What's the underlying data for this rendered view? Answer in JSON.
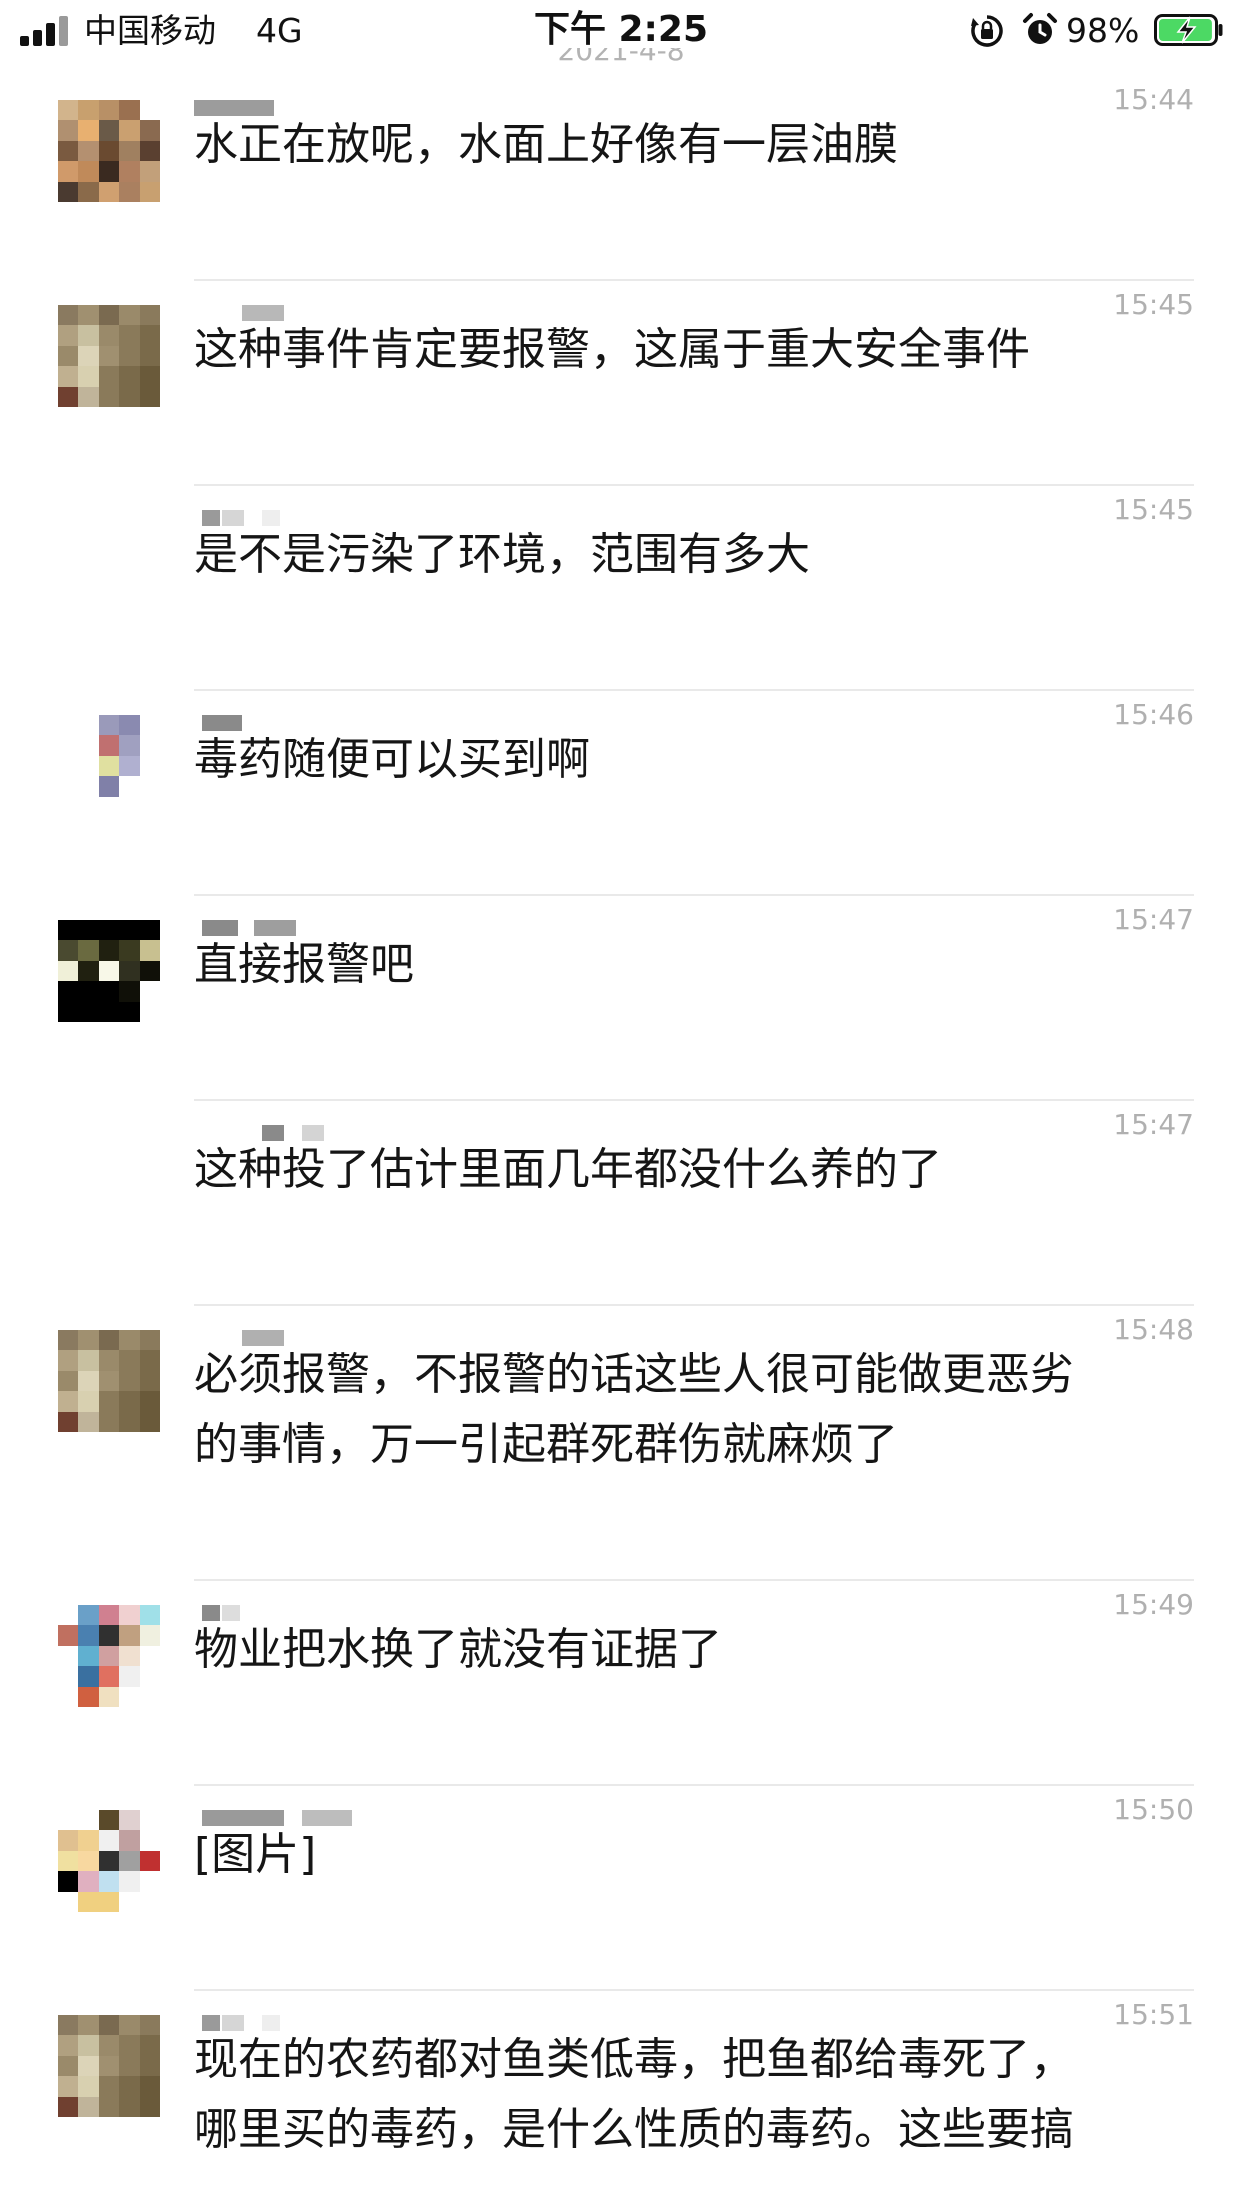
{
  "status_bar": {
    "carrier": "中国移动",
    "network": "4G",
    "time": "下午 2:25",
    "battery_percent": "98%",
    "battery_level": 0.98,
    "icons": [
      "signal-icon",
      "rotation-lock-icon",
      "alarm-icon",
      "battery-charging-icon"
    ]
  },
  "date_header": "2021-4-8",
  "colors": {
    "divider": "#e9e9e9",
    "time_text": "#b0b0b0",
    "battery_green": "#4cd964"
  },
  "messages": [
    {
      "time": "15:44",
      "lines": [
        "水正在放呢，水面上好像有一层油膜"
      ]
    },
    {
      "time": "15:45",
      "lines": [
        "这种事件肯定要报警，这属于重大安全事件"
      ]
    },
    {
      "time": "15:45",
      "lines": [
        "是不是污染了环境，范围有多大"
      ]
    },
    {
      "time": "15:46",
      "lines": [
        "毒药随便可以买到啊"
      ]
    },
    {
      "time": "15:47",
      "lines": [
        "直接报警吧"
      ]
    },
    {
      "time": "15:47",
      "lines": [
        "这种投了估计里面几年都没什么养的了"
      ]
    },
    {
      "time": "15:48",
      "lines": [
        "必须报警，不报警的话这些人很可能做更恶劣",
        "的事情，万一引起群死群伤就麻烦了"
      ]
    },
    {
      "time": "15:49",
      "lines": [
        "物业把水换了就没有证据了"
      ]
    },
    {
      "time": "15:50",
      "lines": [
        "[图片]"
      ]
    },
    {
      "time": "15:51",
      "lines": [
        "现在的农药都对鱼类低毒，把鱼都给毒死了，",
        "哪里买的毒药，是什么性质的毒药。这些要搞"
      ]
    }
  ]
}
